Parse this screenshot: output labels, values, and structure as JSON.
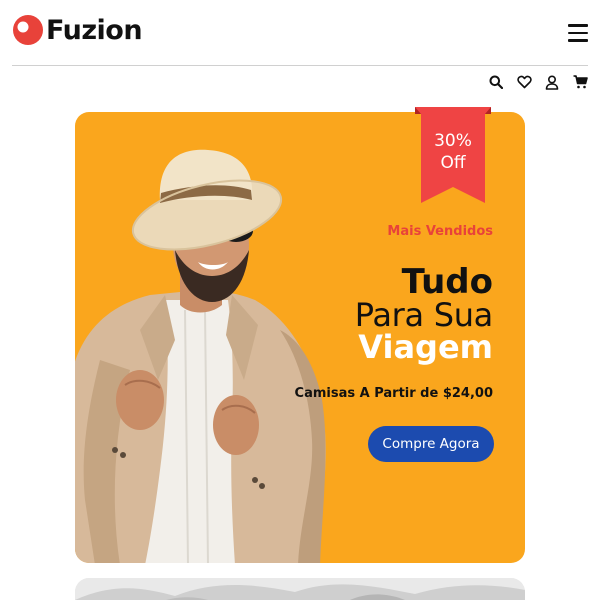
{
  "header": {
    "brand": "Fuzion",
    "brand_color": "#E8423A",
    "menu_icon": "hamburger-menu-icon"
  },
  "toolbar_icons": [
    "search-icon",
    "heart-icon",
    "user-icon",
    "cart-icon"
  ],
  "hero": {
    "background": "#FAA61D",
    "ribbon": {
      "line1": "30%",
      "line2": "Off",
      "color": "#EF4444"
    },
    "tagline": "Mais Vendidos",
    "title_line1": "Tudo",
    "title_line2": "Para Sua",
    "title_line3": "Viagem",
    "price_text": "Camisas A Partir de $24,00",
    "cta_label": "Compre Agora",
    "cta_color": "#1C4BAF"
  }
}
